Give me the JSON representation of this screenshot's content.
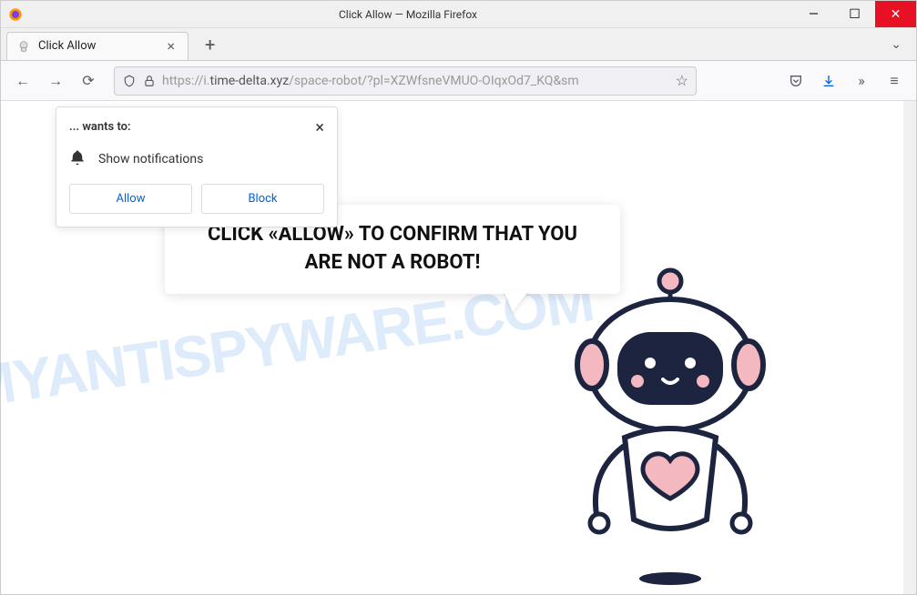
{
  "window": {
    "title": "Click Allow — Mozilla Firefox"
  },
  "tabs": {
    "active": {
      "title": "Click Allow"
    }
  },
  "urlbar": {
    "protocol": "https://",
    "host_prefix": "i.",
    "host": "time-delta.xyz",
    "path": "/space-robot/?pl=XZWfsneVMUO-OIqxOd7_KQ&sm"
  },
  "notification": {
    "wants_text": "... wants to:",
    "permission_text": "Show notifications",
    "allow_label": "Allow",
    "block_label": "Block"
  },
  "bubble": {
    "line1": "CLICK «ALLOW» TO CONFIRM THAT YOU",
    "line2": "ARE NOT A ROBOT!"
  },
  "watermark": {
    "text": "MYANTISPYWARE.COM"
  }
}
